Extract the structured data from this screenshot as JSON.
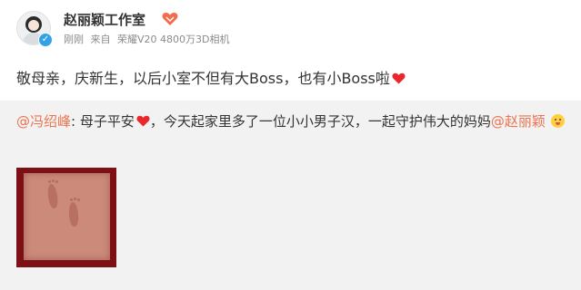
{
  "header": {
    "author_name": "赵丽颖工作室",
    "verified_mark": "✓",
    "meta": {
      "time": "刚刚",
      "from_prefix": "来自",
      "device": "荣耀V20 4800万3D相机"
    }
  },
  "post": {
    "text": "敬母亲，庆新生，以后小室不但有大Boss，也有小Boss啦"
  },
  "repost": {
    "author_mention": "@冯绍峰",
    "colon": ":",
    "text_part1": " 母子平安",
    "text_part2": "，今天起家里多了一位小小男子汉，一起守护伟大的妈妈",
    "mention2": "@赵丽颖"
  },
  "icons": {
    "heart_color": "#e8282b",
    "verified_color": "#33a3e8",
    "mention_color": "#eb7350"
  }
}
